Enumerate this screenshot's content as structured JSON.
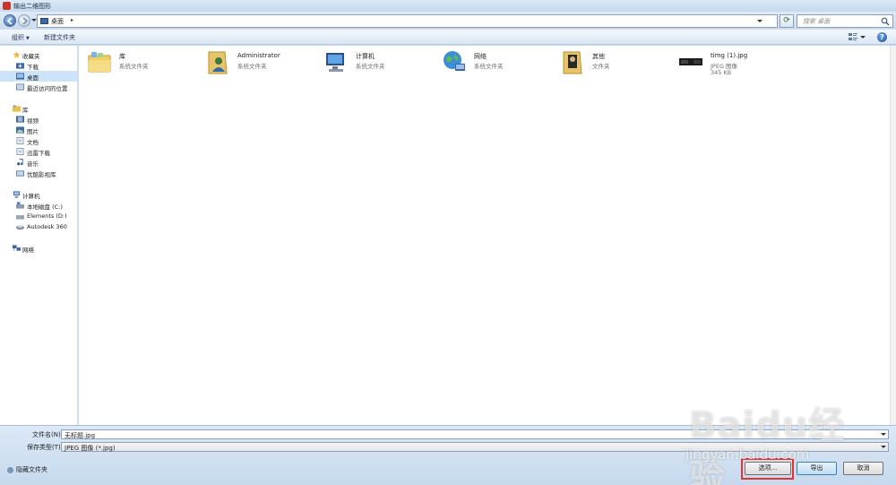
{
  "window": {
    "title": "输出二维图形"
  },
  "address": {
    "path": "桌面",
    "separator": "▸"
  },
  "search": {
    "placeholder": "搜索 桌面"
  },
  "toolbar": {
    "organize_label": "组织",
    "new_folder_label": "新建文件夹"
  },
  "sidebar": {
    "favorites": {
      "label": "收藏夹",
      "items": [
        "下载",
        "桌面",
        "最近访问的位置"
      ]
    },
    "libraries": {
      "label": "库",
      "items": [
        "视频",
        "图片",
        "文档",
        "迅雷下载",
        "音乐",
        "优酷影视库"
      ]
    },
    "computer": {
      "label": "计算机",
      "items": [
        "本地磁盘 (C:)",
        "Elements (D:)",
        "Autodesk 360"
      ]
    },
    "network": {
      "label": "网络"
    }
  },
  "files": [
    {
      "name": "库",
      "type": "系统文件夹",
      "size": "",
      "icon": "library-icon"
    },
    {
      "name": "Administrator",
      "type": "系统文件夹",
      "size": "",
      "icon": "user-folder-icon"
    },
    {
      "name": "计算机",
      "type": "系统文件夹",
      "size": "",
      "icon": "computer-icon"
    },
    {
      "name": "网络",
      "type": "系统文件夹",
      "size": "",
      "icon": "network-icon"
    },
    {
      "name": "其他",
      "type": "文件夹",
      "size": "",
      "icon": "folder-icon"
    },
    {
      "name": "timg (1).jpg",
      "type": "JPEG 图像",
      "size": "345 KB",
      "icon": "image-thumbnail-icon"
    }
  ],
  "form": {
    "filename_label": "文件名(N):",
    "filename_value": "无标题.jpg",
    "filetype_label": "保存类型(T):",
    "filetype_value": "JPEG 图像 (*.jpg)"
  },
  "footer": {
    "hide_folders_label": "隐藏文件夹",
    "options_label": "选项...",
    "export_label": "导出",
    "cancel_label": "取消"
  },
  "watermark": {
    "text": "Baidu经验",
    "url": "jingyan.baidu.com"
  },
  "colors": {
    "accent": "#3c7fb1",
    "selection": "#cce3f8",
    "highlight_box": "#e8312f"
  }
}
